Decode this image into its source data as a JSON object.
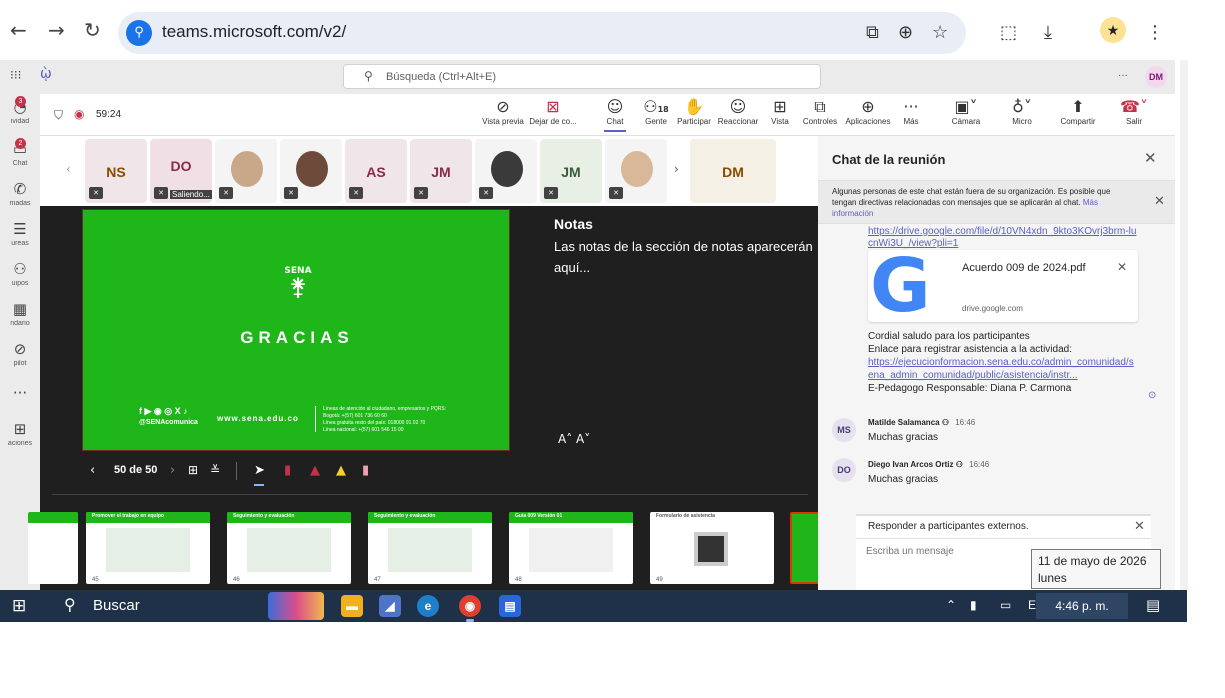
{
  "browser": {
    "url": "teams.microsoft.com/v2/",
    "back_icon": "arrow-left-icon",
    "forward_icon": "arrow-right-icon",
    "reload_icon": "reload-icon"
  },
  "teams_header": {
    "search_placeholder": "Búsqueda (Ctrl+Alt+E)",
    "more": "···",
    "user_initials": "DM"
  },
  "left_rail": [
    {
      "label": "ividad",
      "badge": "3",
      "icon": "bell-icon"
    },
    {
      "label": "Chat",
      "badge": "2",
      "icon": "chat-icon"
    },
    {
      "label": "madas",
      "badge": "",
      "icon": "phone-icon"
    },
    {
      "label": "ureas",
      "badge": "",
      "icon": "tasks-icon"
    },
    {
      "label": "uipos",
      "badge": "",
      "icon": "teams-icon"
    },
    {
      "label": "ndario",
      "badge": "",
      "icon": "calendar-icon"
    },
    {
      "label": "pilot",
      "badge": "",
      "icon": "copilot-icon"
    },
    {
      "label": "",
      "badge": "",
      "icon": "more-icon"
    },
    {
      "label": "aciones",
      "badge": "",
      "icon": "apps-icon"
    }
  ],
  "meeting": {
    "timer": "59:24",
    "toolbar": {
      "preview": "Vista previa",
      "stop": "Dejar de co...",
      "chat": "Chat",
      "people": "Gente",
      "people_count": "18",
      "raise": "Participar",
      "react": "Reaccionar",
      "view": "Vista",
      "controls": "Controles",
      "apps": "Aplicaciones",
      "more": "Más",
      "camera": "Cámara",
      "mic": "Micro",
      "share": "Compartir",
      "leave": "Salir"
    },
    "participants": [
      {
        "initials": "NS",
        "color": "#8a4a00",
        "photo": false
      },
      {
        "initials": "DO",
        "color": "#8a2a4a",
        "photo": false,
        "name": "Saliendo..."
      },
      {
        "initials": "",
        "color": "",
        "photo": true,
        "shade": "#c9a88a"
      },
      {
        "initials": "",
        "color": "",
        "photo": true,
        "shade": "#6e4a3a"
      },
      {
        "initials": "AS",
        "color": "#8a2a4a",
        "photo": false
      },
      {
        "initials": "JM",
        "color": "#8a2a4a",
        "photo": false
      },
      {
        "initials": "",
        "color": "",
        "photo": true,
        "shade": "#3a3a3a"
      },
      {
        "initials": "JM",
        "color": "#3a5a3a",
        "photo": false
      },
      {
        "initials": "",
        "color": "",
        "photo": true,
        "shade": "#d9b89a"
      }
    ],
    "self_tile": "DM"
  },
  "slide": {
    "logo_text": "SENA",
    "heading": "GRACIAS",
    "social_icons": "f ▶ ◉ ◎ X ♪",
    "handle": "@SENAcomunica",
    "site": "www.sena.edu.co",
    "contact_lines": [
      "Líneas de atención al ciudadano, empresarios y PQRS:",
      "Bogotá: +(57) 601 736 60 60",
      "Línea gratuita resto del país: 018000 91 02 70",
      "Línea nacional: +(57) 601 546 15 00"
    ]
  },
  "notes": {
    "title": "Notas",
    "body": "Las notas de la sección de notas aparecerán aquí...",
    "font_controls": "A˄  A˅"
  },
  "slide_nav": {
    "counter": "50 de 50"
  },
  "thumbnails": [
    {
      "title": "",
      "num": ""
    },
    {
      "title": "Promover el trabajo en equipo",
      "num": "45"
    },
    {
      "title": "Seguimiento y evaluación",
      "num": "46"
    },
    {
      "title": "Seguimiento y evaluación",
      "num": "47"
    },
    {
      "title": "Guía 009 Versión 01",
      "num": "48"
    },
    {
      "title": "Formulario de asistencia",
      "num": "49"
    }
  ],
  "chat": {
    "title": "Chat de la reunión",
    "banner": "Algunas personas de este chat están fuera de su organización. Es posible que tengan directivas relacionadas con mensajes que se aplicarán al chat.",
    "banner_link": "Más información",
    "top_link": "https://drive.google.com/file/d/10VN4xdn_9kto3KOvrj3brm-lucnWi3U_/view?pli=1",
    "file_name": "Acuerdo 009 de 2024.pdf",
    "file_source": "drive.google.com",
    "msg_line1": "Cordial saludo para los participantes",
    "msg_line2": "Enlace para registrar asistencia a la actividad:",
    "msg_link": "https://ejecucionformacion.sena.edu.co/admin_comunidad/sena_admin_comunidad/public/asistencia/instr...",
    "msg_line3": "E-Pedagogo Responsable: Diana P. Carmona",
    "messages": [
      {
        "initials": "MS",
        "author": "Matilde Salamanca",
        "time": "16:46",
        "text": "Muchas gracias"
      },
      {
        "initials": "DO",
        "author": "Diego Ivan Arcos Ortiz",
        "time": "16:46",
        "text": "Muchas gracias"
      }
    ],
    "reply_header": "Responder a participantes externos.",
    "reply_placeholder": "Escriba un mensaje"
  },
  "date_tooltip": {
    "date": "11 de mayo de 2026",
    "day": "lunes"
  },
  "taskbar": {
    "search": "Buscar",
    "lang": "ESP",
    "time": "4:46 p. m."
  }
}
